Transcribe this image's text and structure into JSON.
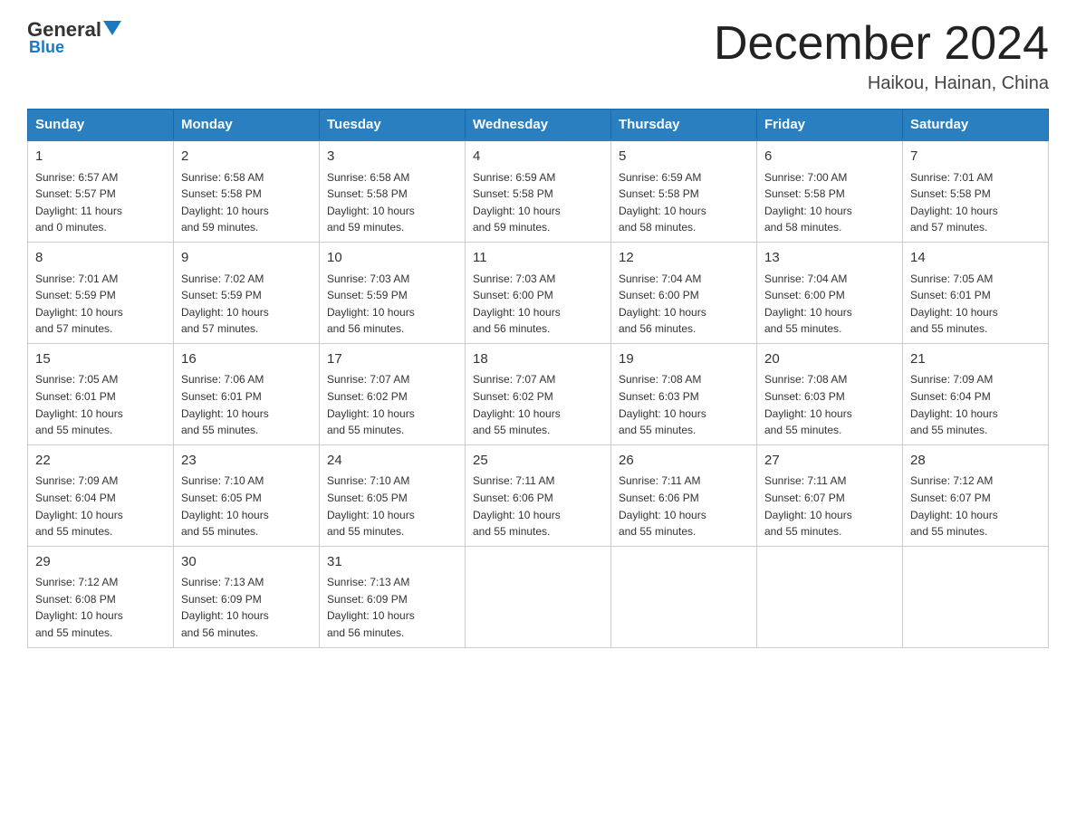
{
  "logo": {
    "general": "General",
    "blue": "Blue"
  },
  "header": {
    "month_title": "December 2024",
    "location": "Haikou, Hainan, China"
  },
  "days_header": [
    "Sunday",
    "Monday",
    "Tuesday",
    "Wednesday",
    "Thursday",
    "Friday",
    "Saturday"
  ],
  "weeks": [
    [
      {
        "day": "1",
        "info": "Sunrise: 6:57 AM\nSunset: 5:57 PM\nDaylight: 11 hours\nand 0 minutes."
      },
      {
        "day": "2",
        "info": "Sunrise: 6:58 AM\nSunset: 5:58 PM\nDaylight: 10 hours\nand 59 minutes."
      },
      {
        "day": "3",
        "info": "Sunrise: 6:58 AM\nSunset: 5:58 PM\nDaylight: 10 hours\nand 59 minutes."
      },
      {
        "day": "4",
        "info": "Sunrise: 6:59 AM\nSunset: 5:58 PM\nDaylight: 10 hours\nand 59 minutes."
      },
      {
        "day": "5",
        "info": "Sunrise: 6:59 AM\nSunset: 5:58 PM\nDaylight: 10 hours\nand 58 minutes."
      },
      {
        "day": "6",
        "info": "Sunrise: 7:00 AM\nSunset: 5:58 PM\nDaylight: 10 hours\nand 58 minutes."
      },
      {
        "day": "7",
        "info": "Sunrise: 7:01 AM\nSunset: 5:58 PM\nDaylight: 10 hours\nand 57 minutes."
      }
    ],
    [
      {
        "day": "8",
        "info": "Sunrise: 7:01 AM\nSunset: 5:59 PM\nDaylight: 10 hours\nand 57 minutes."
      },
      {
        "day": "9",
        "info": "Sunrise: 7:02 AM\nSunset: 5:59 PM\nDaylight: 10 hours\nand 57 minutes."
      },
      {
        "day": "10",
        "info": "Sunrise: 7:03 AM\nSunset: 5:59 PM\nDaylight: 10 hours\nand 56 minutes."
      },
      {
        "day": "11",
        "info": "Sunrise: 7:03 AM\nSunset: 6:00 PM\nDaylight: 10 hours\nand 56 minutes."
      },
      {
        "day": "12",
        "info": "Sunrise: 7:04 AM\nSunset: 6:00 PM\nDaylight: 10 hours\nand 56 minutes."
      },
      {
        "day": "13",
        "info": "Sunrise: 7:04 AM\nSunset: 6:00 PM\nDaylight: 10 hours\nand 55 minutes."
      },
      {
        "day": "14",
        "info": "Sunrise: 7:05 AM\nSunset: 6:01 PM\nDaylight: 10 hours\nand 55 minutes."
      }
    ],
    [
      {
        "day": "15",
        "info": "Sunrise: 7:05 AM\nSunset: 6:01 PM\nDaylight: 10 hours\nand 55 minutes."
      },
      {
        "day": "16",
        "info": "Sunrise: 7:06 AM\nSunset: 6:01 PM\nDaylight: 10 hours\nand 55 minutes."
      },
      {
        "day": "17",
        "info": "Sunrise: 7:07 AM\nSunset: 6:02 PM\nDaylight: 10 hours\nand 55 minutes."
      },
      {
        "day": "18",
        "info": "Sunrise: 7:07 AM\nSunset: 6:02 PM\nDaylight: 10 hours\nand 55 minutes."
      },
      {
        "day": "19",
        "info": "Sunrise: 7:08 AM\nSunset: 6:03 PM\nDaylight: 10 hours\nand 55 minutes."
      },
      {
        "day": "20",
        "info": "Sunrise: 7:08 AM\nSunset: 6:03 PM\nDaylight: 10 hours\nand 55 minutes."
      },
      {
        "day": "21",
        "info": "Sunrise: 7:09 AM\nSunset: 6:04 PM\nDaylight: 10 hours\nand 55 minutes."
      }
    ],
    [
      {
        "day": "22",
        "info": "Sunrise: 7:09 AM\nSunset: 6:04 PM\nDaylight: 10 hours\nand 55 minutes."
      },
      {
        "day": "23",
        "info": "Sunrise: 7:10 AM\nSunset: 6:05 PM\nDaylight: 10 hours\nand 55 minutes."
      },
      {
        "day": "24",
        "info": "Sunrise: 7:10 AM\nSunset: 6:05 PM\nDaylight: 10 hours\nand 55 minutes."
      },
      {
        "day": "25",
        "info": "Sunrise: 7:11 AM\nSunset: 6:06 PM\nDaylight: 10 hours\nand 55 minutes."
      },
      {
        "day": "26",
        "info": "Sunrise: 7:11 AM\nSunset: 6:06 PM\nDaylight: 10 hours\nand 55 minutes."
      },
      {
        "day": "27",
        "info": "Sunrise: 7:11 AM\nSunset: 6:07 PM\nDaylight: 10 hours\nand 55 minutes."
      },
      {
        "day": "28",
        "info": "Sunrise: 7:12 AM\nSunset: 6:07 PM\nDaylight: 10 hours\nand 55 minutes."
      }
    ],
    [
      {
        "day": "29",
        "info": "Sunrise: 7:12 AM\nSunset: 6:08 PM\nDaylight: 10 hours\nand 55 minutes."
      },
      {
        "day": "30",
        "info": "Sunrise: 7:13 AM\nSunset: 6:09 PM\nDaylight: 10 hours\nand 56 minutes."
      },
      {
        "day": "31",
        "info": "Sunrise: 7:13 AM\nSunset: 6:09 PM\nDaylight: 10 hours\nand 56 minutes."
      },
      {
        "day": "",
        "info": ""
      },
      {
        "day": "",
        "info": ""
      },
      {
        "day": "",
        "info": ""
      },
      {
        "day": "",
        "info": ""
      }
    ]
  ]
}
